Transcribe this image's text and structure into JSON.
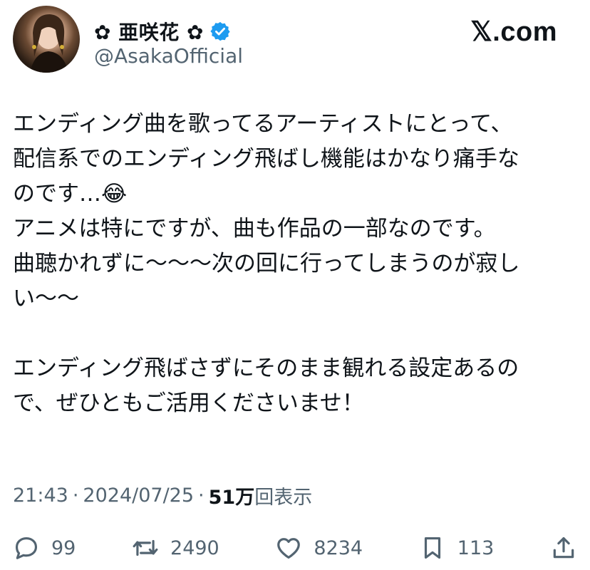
{
  "user": {
    "display_name": "✿ 亜咲花 ✿",
    "handle": "@AsakaOfficial",
    "verified": true
  },
  "brand": "𝕏.com",
  "tweet": {
    "text": "エンディング曲を歌ってるアーティストにとって、\n配信系でのエンディング飛ばし機能はかなり痛手な\nのです…😂\nアニメは特にですが、曲も作品の一部なのです。\n曲聴かれずに〜〜〜次の回に行ってしまうのが寂し\nい〜〜\n\nエンディング飛ばさずにそのまま観れる設定あるの\nで、ぜひともご活用くださいませ！"
  },
  "meta": {
    "time": "21:43",
    "separator": "·",
    "date": "2024/07/25",
    "views_count": "51万",
    "views_label": "回表示"
  },
  "actions": {
    "replies": "99",
    "reposts": "2490",
    "likes": "8234",
    "bookmarks": "113"
  },
  "colors": {
    "text": "#0f1419",
    "secondary": "#536471",
    "verified_badge": "#1d9bf0"
  },
  "icons": [
    "reply-icon",
    "repost-icon",
    "like-icon",
    "bookmark-icon",
    "share-icon",
    "verified-badge-icon"
  ]
}
